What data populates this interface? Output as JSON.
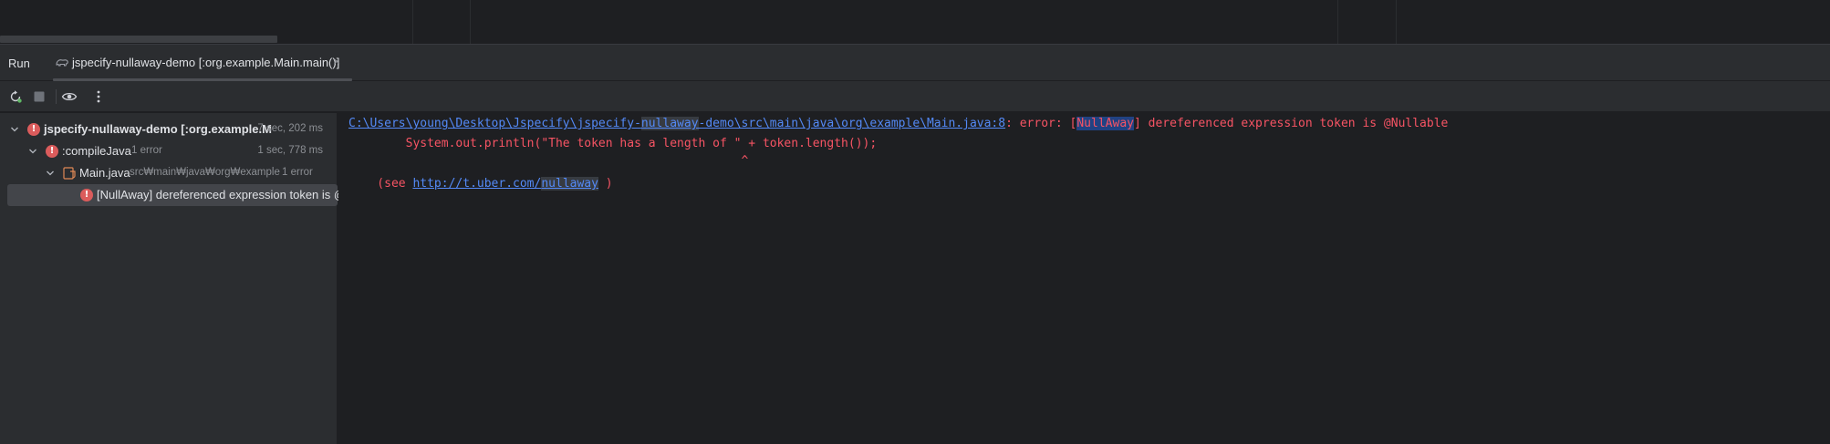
{
  "run_window": {
    "title": "Run",
    "tab": {
      "label": "jspecify-nullaway-demo [:org.example.Main.main()]",
      "close_glyph": "×",
      "icon": "gradle-icon"
    }
  },
  "toolbar": {
    "buttons": [
      "rerun-icon",
      "stop-icon",
      "eye-icon",
      "more-vertical-icon"
    ]
  },
  "tree": {
    "root": {
      "label": "jspecify-nullaway-demo [:org.example.M",
      "time": "7 sec, 202 ms"
    },
    "task": {
      "label": ":compileJava",
      "meta": "1 error",
      "time": "1 sec, 778 ms"
    },
    "file": {
      "label": "Main.java",
      "path": "src₩main₩java₩org₩example",
      "meta": "1 error"
    },
    "message": {
      "label": "[NullAway] dereferenced expression token is @N"
    }
  },
  "console": {
    "line1": {
      "path_a": "C:\\Users\\young\\Desktop\\Jspecify\\jspecify-",
      "path_b": "nullaway",
      "path_c": "-demo\\src\\main\\java\\org\\example\\Main.java:8",
      "msg_a": ": error: [",
      "msg_b": "NullAway",
      "msg_c": "] dereferenced expression token is @Nullable"
    },
    "line2": "        System.out.println(\"The token has a length of \" + token.length());",
    "line3": "                                                       ^",
    "line4": {
      "prefix": "    (see ",
      "url_a": "http://t.uber.com/",
      "url_b": "nullaway",
      "suffix": " )"
    }
  },
  "colors": {
    "error": "#f75464",
    "link": "#548af7",
    "panel": "#2b2d30",
    "editor": "#1e1f22"
  }
}
